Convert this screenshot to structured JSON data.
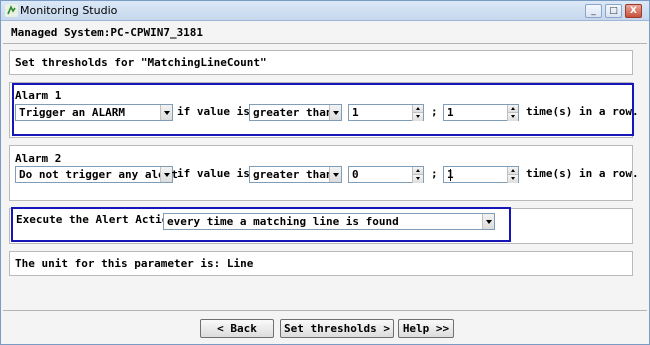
{
  "window": {
    "title": "Monitoring Studio",
    "minimize_glyph": "_",
    "maximize_glyph": "□",
    "close_glyph": "X"
  },
  "header": {
    "managed_system": "Managed System:PC-CPWIN7_3181"
  },
  "thresholds_panel": {
    "title": "Set thresholds for \"MatchingLineCount\""
  },
  "alarm1": {
    "title": "Alarm 1",
    "action": "Trigger an ALARM",
    "if_label": "if value is",
    "operator": "greater than",
    "value": "1",
    "separator": ";",
    "times": "1",
    "suffix": "time(s) in a row."
  },
  "alarm2": {
    "title": "Alarm 2",
    "action": "Do not trigger any alert",
    "if_label": "if value is",
    "operator": "greater than",
    "value": "0",
    "separator": ";",
    "times": "1",
    "suffix": "time(s) in a row."
  },
  "alert_actions": {
    "label": "Execute the Alert Actions",
    "mode": "every time a matching line is found"
  },
  "unit_panel": {
    "text": "The unit for this parameter is: Line"
  },
  "buttons": {
    "back": "< Back",
    "set_thresholds": "Set thresholds >",
    "help": "Help >>"
  }
}
